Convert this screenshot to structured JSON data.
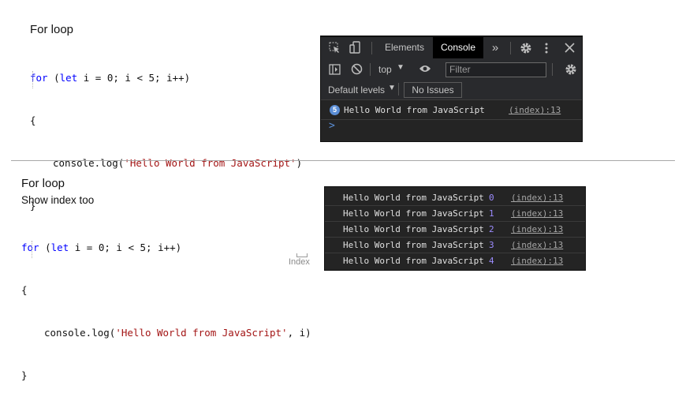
{
  "top": {
    "title": "For loop",
    "code": {
      "line1_kw1": "for",
      "line1_paren": "(",
      "line1_kw2": "let",
      "line1_rest": " i = 0; i < 5; i++)",
      "line2": "{",
      "line3_pre": "console.log(",
      "line3_str": "'Hello World from JavaScript'",
      "line3_post": ")",
      "line4": "}"
    }
  },
  "devtools": {
    "tabs": {
      "elements": "Elements",
      "console": "Console",
      "more": "»"
    },
    "context": "top",
    "filter_placeholder": "Filter",
    "levels": "Default levels",
    "issues": "No Issues",
    "message": {
      "count": "5",
      "text": "Hello World from JavaScript",
      "source": "(index):13"
    },
    "prompt": ">",
    "icons": [
      "inspect-icon",
      "device-icon",
      "settings-icon",
      "kebab-menu-icon",
      "close-icon",
      "sidebar-icon",
      "clear-icon",
      "eye-icon",
      "gear-icon"
    ]
  },
  "bottom": {
    "title": "For loop",
    "subtitle": "Show index too",
    "code": {
      "line1_kw1": "for",
      "line1_paren": "(",
      "line1_kw2": "let",
      "line1_rest": " i = 0; i < 5; i++)",
      "line2": "{",
      "line3_pre": "console.log(",
      "line3_str": "'Hello World from JavaScript'",
      "line3_post": ", ",
      "line3_var": "i",
      "line3_close": ")",
      "line4": "}"
    },
    "annotation": "Index"
  },
  "output": {
    "rows": [
      {
        "text": "Hello World from JavaScript",
        "num": "0",
        "source": "(index):13"
      },
      {
        "text": "Hello World from JavaScript",
        "num": "1",
        "source": "(index):13"
      },
      {
        "text": "Hello World from JavaScript",
        "num": "2",
        "source": "(index):13"
      },
      {
        "text": "Hello World from JavaScript",
        "num": "3",
        "source": "(index):13"
      },
      {
        "text": "Hello World from JavaScript",
        "num": "4",
        "source": "(index):13"
      }
    ]
  },
  "colors": {
    "keyword": "#0000ff",
    "string": "#a31515",
    "devtools_bg": "#242424",
    "number": "#9c8cff",
    "badge": "#5b8ed6"
  }
}
